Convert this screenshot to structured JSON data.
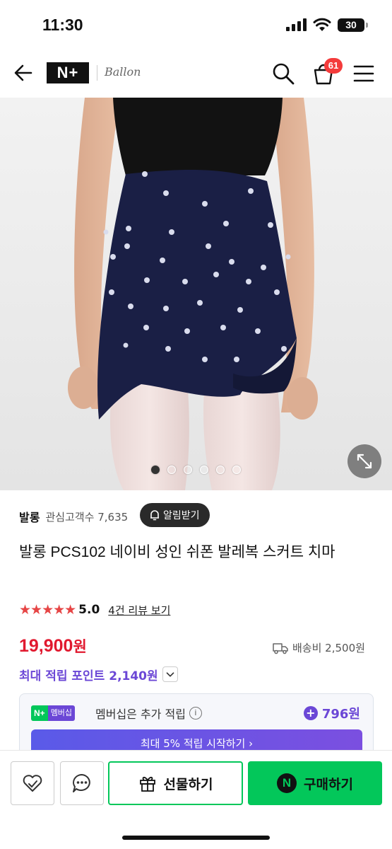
{
  "status_bar": {
    "time": "11:30",
    "battery": "30"
  },
  "header": {
    "np_badge": "N+",
    "brand": "Ballon",
    "cart_count": "61"
  },
  "product": {
    "image_dots": 6,
    "active_dot": 0,
    "seller": "발롱",
    "followers_label": "관심고객수 7,635",
    "alarm_button": "알림받기",
    "title": "발롱 PCS102 네이비 성인 쉬폰 발레복 스커트 치마",
    "stars": "★★★★★",
    "rating": "5.0",
    "review_link": "4건 리뷰 보기",
    "price": "19,900",
    "price_unit": "원",
    "shipping": "배송비 2,500원",
    "max_points": "최대 적립 포인트 2,140원"
  },
  "membership": {
    "badge_np": "N+",
    "badge_member": "멤버십",
    "text": "멤버십은 추가 적립",
    "info_icon_text": "i",
    "points": "796원",
    "start_button": "최대 5% 적립 시작하기 ›"
  },
  "bottom_bar": {
    "gift_label": "선물하기",
    "buy_label": "구매하기",
    "buy_icon_letter": "N"
  },
  "colors": {
    "naver_green": "#03c75a",
    "price_red": "#e1192f",
    "points_purple": "#6b47d6",
    "star_red": "#e64545"
  }
}
